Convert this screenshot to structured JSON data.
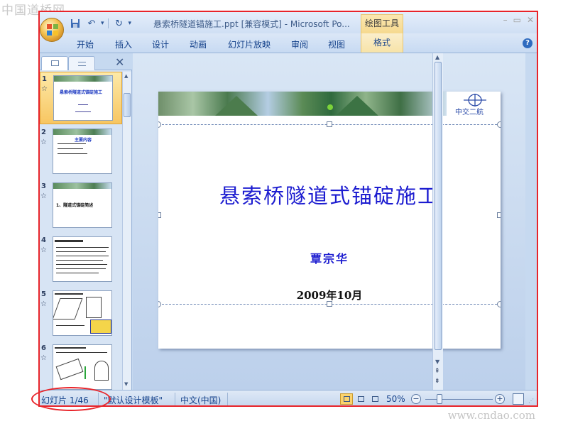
{
  "watermark_top": "中国道桥网",
  "watermark_bottom": "www.cndao.com",
  "window": {
    "title": "悬索桥隧道锚施工.ppt [兼容模式] - Microsoft Po...",
    "context_tab_group": "绘图工具"
  },
  "qat": {
    "save_icon": "save-icon",
    "undo_icon": "undo-icon",
    "redo_icon": "redo-icon"
  },
  "ribbon": {
    "tabs": [
      "开始",
      "插入",
      "设计",
      "动画",
      "幻灯片放映",
      "审阅",
      "视图"
    ],
    "context_tab": "格式"
  },
  "slides_pane": {
    "thumbs": [
      {
        "num": "1",
        "title": "悬索桥隧道式锚碇施工"
      },
      {
        "num": "2",
        "title": "主要内容"
      },
      {
        "num": "3",
        "title": "1、隧道式锚碇简述"
      },
      {
        "num": "4",
        "title": ""
      },
      {
        "num": "5",
        "title": ""
      },
      {
        "num": "6",
        "title": ""
      }
    ]
  },
  "slide": {
    "logo_text": "中交二航",
    "title": "悬索桥隧道式锚碇施工",
    "author": "覃宗华",
    "date": "2009年10月"
  },
  "status": {
    "slide_label": "幻灯片 1/46",
    "template": "\"默认设计模板\"",
    "language": "中文(中国)",
    "zoom": "50%"
  },
  "colors": {
    "highlight_red": "#e8242a",
    "slide_title_blue": "#1c1cd0",
    "ribbon_text": "#15428b",
    "active_thumb": "#f7c662"
  }
}
